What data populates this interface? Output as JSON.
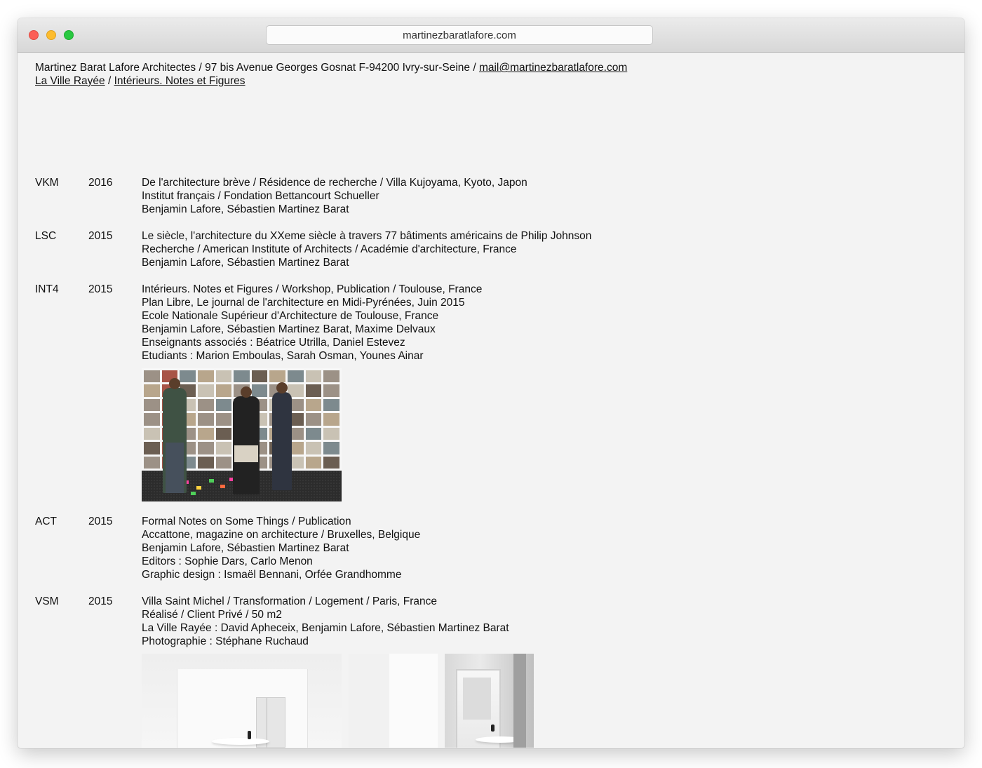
{
  "browser": {
    "url": "martinezbaratlafore.com"
  },
  "header": {
    "address": "Martinez Barat Lafore Architectes / 97 bis Avenue Georges Gosnat F-94200 Ivry-sur-Seine / ",
    "email": "mail@martinezbaratlafore.com",
    "link1": "La Ville Rayée",
    "separator": " / ",
    "link2": "Intérieurs. Notes et Figures"
  },
  "entries": [
    {
      "code": "VKM",
      "year": "2016",
      "lines": [
        "De l'architecture brève / Résidence de recherche / Villa Kujoyama, Kyoto, Japon",
        "Institut français / Fondation Bettancourt Schueller",
        "Benjamin Lafore, Sébastien Martinez Barat"
      ]
    },
    {
      "code": "LSC",
      "year": "2015",
      "lines": [
        "Le siècle, l'architecture du XXeme siècle à travers 77 bâtiments américains de Philip Johnson",
        "Recherche / American Institute of Architects / Académie d'architecture, France",
        "Benjamin Lafore, Sébastien Martinez Barat"
      ]
    },
    {
      "code": "INT4",
      "year": "2015",
      "lines": [
        "Intérieurs. Notes et Figures / Workshop, Publication / Toulouse, France",
        "Plan Libre, Le journal de l'architecture en Midi-Pyrénées, Juin 2015",
        "Ecole Nationale Supérieur d'Architecture de Toulouse, France",
        "Benjamin Lafore, Sébastien Martinez Barat, Maxime Delvaux",
        "Enseignants associés : Béatrice Utrilla, Daniel Estevez",
        "Etudiants : Marion Emboulas, Sarah Osman, Younes Ainar"
      ]
    },
    {
      "code": "ACT",
      "year": "2015",
      "lines": [
        "Formal Notes on Some Things / Publication",
        "Accattone, magazine on architecture / Bruxelles, Belgique",
        "Benjamin Lafore, Sébastien Martinez Barat",
        "Editors : Sophie Dars, Carlo Menon",
        "Graphic design : Ismaël Bennani, Orfée Grandhomme"
      ]
    },
    {
      "code": "VSM",
      "year": "2015",
      "lines": [
        "Villa Saint Michel / Transformation / Logement / Paris, France",
        "Réalisé / Client Privé / 50 m2",
        "La Ville Rayée : David Apheceix, Benjamin Lafore, Sébastien Martinez Barat",
        "Photographie : Stéphane Ruchaud"
      ]
    }
  ]
}
